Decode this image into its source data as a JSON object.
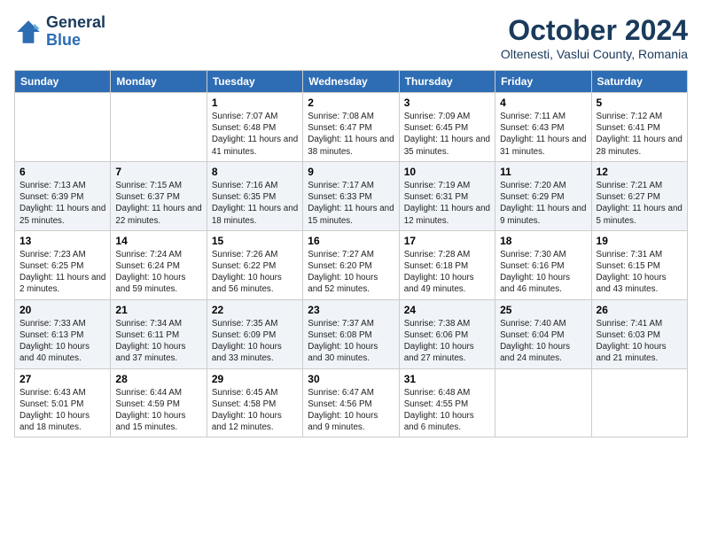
{
  "header": {
    "logo_line1": "General",
    "logo_line2": "Blue",
    "month": "October 2024",
    "location": "Oltenesti, Vaslui County, Romania"
  },
  "weekdays": [
    "Sunday",
    "Monday",
    "Tuesday",
    "Wednesday",
    "Thursday",
    "Friday",
    "Saturday"
  ],
  "rows": [
    [
      {
        "day": "",
        "detail": ""
      },
      {
        "day": "",
        "detail": ""
      },
      {
        "day": "1",
        "detail": "Sunrise: 7:07 AM\nSunset: 6:48 PM\nDaylight: 11 hours and 41 minutes."
      },
      {
        "day": "2",
        "detail": "Sunrise: 7:08 AM\nSunset: 6:47 PM\nDaylight: 11 hours and 38 minutes."
      },
      {
        "day": "3",
        "detail": "Sunrise: 7:09 AM\nSunset: 6:45 PM\nDaylight: 11 hours and 35 minutes."
      },
      {
        "day": "4",
        "detail": "Sunrise: 7:11 AM\nSunset: 6:43 PM\nDaylight: 11 hours and 31 minutes."
      },
      {
        "day": "5",
        "detail": "Sunrise: 7:12 AM\nSunset: 6:41 PM\nDaylight: 11 hours and 28 minutes."
      }
    ],
    [
      {
        "day": "6",
        "detail": "Sunrise: 7:13 AM\nSunset: 6:39 PM\nDaylight: 11 hours and 25 minutes."
      },
      {
        "day": "7",
        "detail": "Sunrise: 7:15 AM\nSunset: 6:37 PM\nDaylight: 11 hours and 22 minutes."
      },
      {
        "day": "8",
        "detail": "Sunrise: 7:16 AM\nSunset: 6:35 PM\nDaylight: 11 hours and 18 minutes."
      },
      {
        "day": "9",
        "detail": "Sunrise: 7:17 AM\nSunset: 6:33 PM\nDaylight: 11 hours and 15 minutes."
      },
      {
        "day": "10",
        "detail": "Sunrise: 7:19 AM\nSunset: 6:31 PM\nDaylight: 11 hours and 12 minutes."
      },
      {
        "day": "11",
        "detail": "Sunrise: 7:20 AM\nSunset: 6:29 PM\nDaylight: 11 hours and 9 minutes."
      },
      {
        "day": "12",
        "detail": "Sunrise: 7:21 AM\nSunset: 6:27 PM\nDaylight: 11 hours and 5 minutes."
      }
    ],
    [
      {
        "day": "13",
        "detail": "Sunrise: 7:23 AM\nSunset: 6:25 PM\nDaylight: 11 hours and 2 minutes."
      },
      {
        "day": "14",
        "detail": "Sunrise: 7:24 AM\nSunset: 6:24 PM\nDaylight: 10 hours and 59 minutes."
      },
      {
        "day": "15",
        "detail": "Sunrise: 7:26 AM\nSunset: 6:22 PM\nDaylight: 10 hours and 56 minutes."
      },
      {
        "day": "16",
        "detail": "Sunrise: 7:27 AM\nSunset: 6:20 PM\nDaylight: 10 hours and 52 minutes."
      },
      {
        "day": "17",
        "detail": "Sunrise: 7:28 AM\nSunset: 6:18 PM\nDaylight: 10 hours and 49 minutes."
      },
      {
        "day": "18",
        "detail": "Sunrise: 7:30 AM\nSunset: 6:16 PM\nDaylight: 10 hours and 46 minutes."
      },
      {
        "day": "19",
        "detail": "Sunrise: 7:31 AM\nSunset: 6:15 PM\nDaylight: 10 hours and 43 minutes."
      }
    ],
    [
      {
        "day": "20",
        "detail": "Sunrise: 7:33 AM\nSunset: 6:13 PM\nDaylight: 10 hours and 40 minutes."
      },
      {
        "day": "21",
        "detail": "Sunrise: 7:34 AM\nSunset: 6:11 PM\nDaylight: 10 hours and 37 minutes."
      },
      {
        "day": "22",
        "detail": "Sunrise: 7:35 AM\nSunset: 6:09 PM\nDaylight: 10 hours and 33 minutes."
      },
      {
        "day": "23",
        "detail": "Sunrise: 7:37 AM\nSunset: 6:08 PM\nDaylight: 10 hours and 30 minutes."
      },
      {
        "day": "24",
        "detail": "Sunrise: 7:38 AM\nSunset: 6:06 PM\nDaylight: 10 hours and 27 minutes."
      },
      {
        "day": "25",
        "detail": "Sunrise: 7:40 AM\nSunset: 6:04 PM\nDaylight: 10 hours and 24 minutes."
      },
      {
        "day": "26",
        "detail": "Sunrise: 7:41 AM\nSunset: 6:03 PM\nDaylight: 10 hours and 21 minutes."
      }
    ],
    [
      {
        "day": "27",
        "detail": "Sunrise: 6:43 AM\nSunset: 5:01 PM\nDaylight: 10 hours and 18 minutes."
      },
      {
        "day": "28",
        "detail": "Sunrise: 6:44 AM\nSunset: 4:59 PM\nDaylight: 10 hours and 15 minutes."
      },
      {
        "day": "29",
        "detail": "Sunrise: 6:45 AM\nSunset: 4:58 PM\nDaylight: 10 hours and 12 minutes."
      },
      {
        "day": "30",
        "detail": "Sunrise: 6:47 AM\nSunset: 4:56 PM\nDaylight: 10 hours and 9 minutes."
      },
      {
        "day": "31",
        "detail": "Sunrise: 6:48 AM\nSunset: 4:55 PM\nDaylight: 10 hours and 6 minutes."
      },
      {
        "day": "",
        "detail": ""
      },
      {
        "day": "",
        "detail": ""
      }
    ]
  ]
}
